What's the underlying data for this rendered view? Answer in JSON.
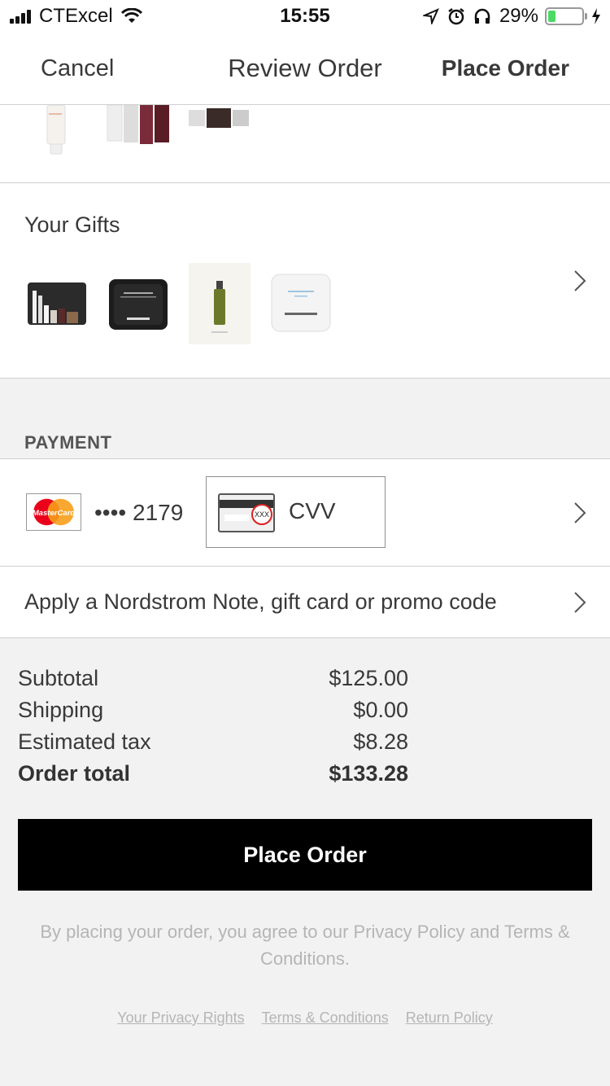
{
  "status_bar": {
    "carrier": "CTExcel",
    "time": "15:55",
    "battery": "29%",
    "battery_level": 0.29,
    "icons": [
      "signal-icon",
      "wifi-icon",
      "location-icon",
      "alarm-icon",
      "headphones-icon",
      "battery-icon",
      "charging-icon"
    ]
  },
  "nav": {
    "cancel": "Cancel",
    "title": "Review Order",
    "place_order": "Place Order"
  },
  "gifts": {
    "title": "Your Gifts",
    "items": [
      "gift-pouch-set",
      "chanel-cream-sample",
      "green-serum-bottle",
      "chanel-blue-serum-sample"
    ]
  },
  "payment": {
    "section_title": "PAYMENT",
    "card_brand": "MasterCard",
    "card_masked": "•••• 2179",
    "cvv_label": "CVV",
    "cvv_card_text": "XXX"
  },
  "promo": {
    "label": "Apply a Nordstrom Note, gift card or promo code"
  },
  "summary": {
    "rows": [
      {
        "label": "Subtotal",
        "value": "$125.00"
      },
      {
        "label": "Shipping",
        "value": "$0.00"
      },
      {
        "label": "Estimated tax",
        "value": "$8.28"
      }
    ],
    "total_label": "Order total",
    "total_value": "$133.28"
  },
  "place_order_button": "Place Order",
  "legal_text": "By placing your order, you agree to our Privacy Policy and Terms & Conditions.",
  "footer_links": [
    "Your Privacy Rights",
    "Terms & Conditions",
    "Return Policy"
  ],
  "colors": {
    "accent": "#000000",
    "background": "#f2f2f2",
    "text": "#393939",
    "muted": "#b5b5b5",
    "battery": "#4cd964",
    "mastercard_red": "#eb001b",
    "mastercard_yellow": "#f79e1b"
  }
}
